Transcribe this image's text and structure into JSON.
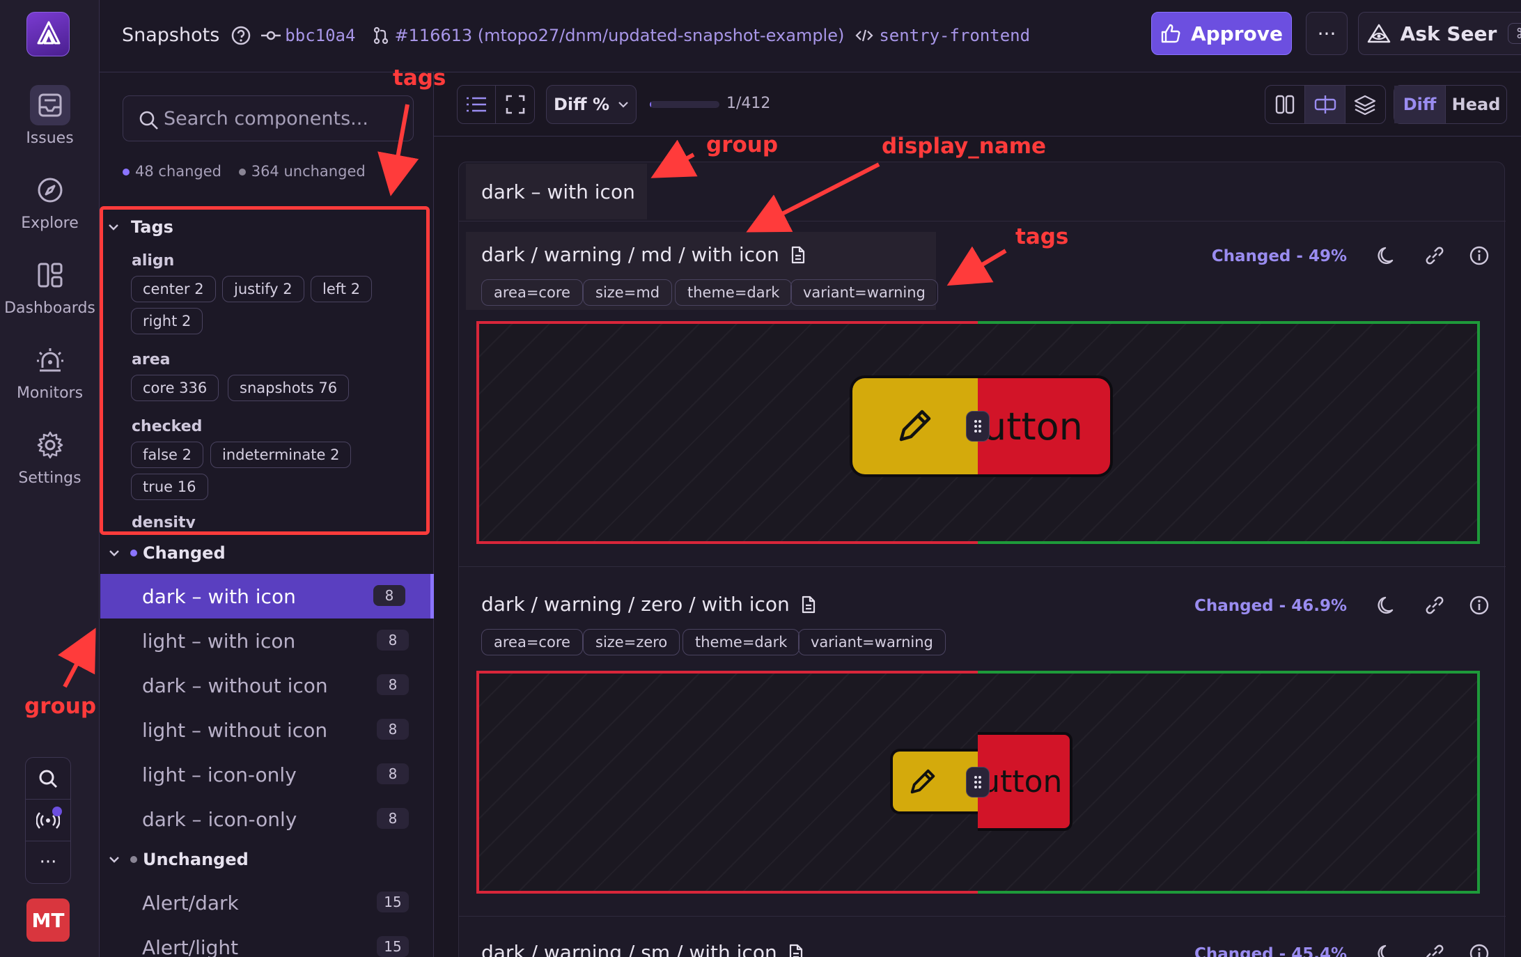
{
  "header": {
    "title": "Snapshots",
    "commit": "bbc10a4",
    "pr": "#116613 (mtopo27/dnm/updated-snapshot-example)",
    "project": "sentry-frontend",
    "approve_label": "Approve",
    "more_label": "···",
    "seer_label": "Ask Seer",
    "seer_shortcut": "⌘ /"
  },
  "rail": {
    "items": [
      {
        "label": "Issues",
        "icon": "inbox-icon"
      },
      {
        "label": "Explore",
        "icon": "compass-icon"
      },
      {
        "label": "Dashboards",
        "icon": "dashboard-icon"
      },
      {
        "label": "Monitors",
        "icon": "siren-icon"
      },
      {
        "label": "Settings",
        "icon": "gear-icon"
      }
    ],
    "more_label": "···",
    "avatar": "MT"
  },
  "sidebar": {
    "search_placeholder": "Search components...",
    "changed_count": "48 changed",
    "unchanged_count": "364 unchanged",
    "tags_header": "Tags",
    "tag_groups": [
      {
        "label": "align",
        "chips": [
          "center 2",
          "justify 2",
          "left 2",
          "right 2"
        ]
      },
      {
        "label": "area",
        "chips": [
          "core 336",
          "snapshots 76"
        ]
      },
      {
        "label": "checked",
        "chips": [
          "false 2",
          "indeterminate 2",
          "true 16"
        ]
      },
      {
        "label": "density",
        "chips": []
      }
    ],
    "changed_header": "Changed",
    "changed_items": [
      {
        "label": "dark – with icon",
        "count": "8"
      },
      {
        "label": "light – with icon",
        "count": "8"
      },
      {
        "label": "dark – without icon",
        "count": "8"
      },
      {
        "label": "light – without icon",
        "count": "8"
      },
      {
        "label": "light – icon-only",
        "count": "8"
      },
      {
        "label": "dark – icon-only",
        "count": "8"
      }
    ],
    "unchanged_header": "Unchanged",
    "unchanged_items": [
      {
        "label": "Alert/dark",
        "count": "15"
      },
      {
        "label": "Alert/light",
        "count": "15"
      }
    ]
  },
  "toolbar": {
    "sort_label": "Diff %",
    "progress": 0.0024,
    "position": "1/412",
    "diff_label": "Diff",
    "head_label": "Head"
  },
  "group_title": "dark – with icon",
  "snapshots": [
    {
      "name": "dark / warning / md / with icon",
      "tags": [
        "area=core",
        "size=md",
        "theme=dark",
        "variant=warning"
      ],
      "status": "Changed - 49%",
      "button_text": "Button"
    },
    {
      "name": "dark / warning / zero / with icon",
      "tags": [
        "area=core",
        "size=zero",
        "theme=dark",
        "variant=warning"
      ],
      "status": "Changed - 46.9%",
      "button_text": "Button"
    },
    {
      "name": "dark / warning / sm / with icon",
      "tags": [],
      "status": "Changed - 45.4%",
      "button_text": ""
    }
  ],
  "annotations": {
    "tags_sidebar": "tags",
    "group_header": "group",
    "display_name": "display_name",
    "tags_snapshot": "tags",
    "group_sidebar": "group"
  },
  "colors": {
    "accent": "#6c4fe0",
    "annotation": "#ff3b3b",
    "diff_removed": "#d8263a",
    "diff_added": "#1e9a3a",
    "button_warning": "#d4aa0c",
    "button_danger": "#d21428"
  }
}
